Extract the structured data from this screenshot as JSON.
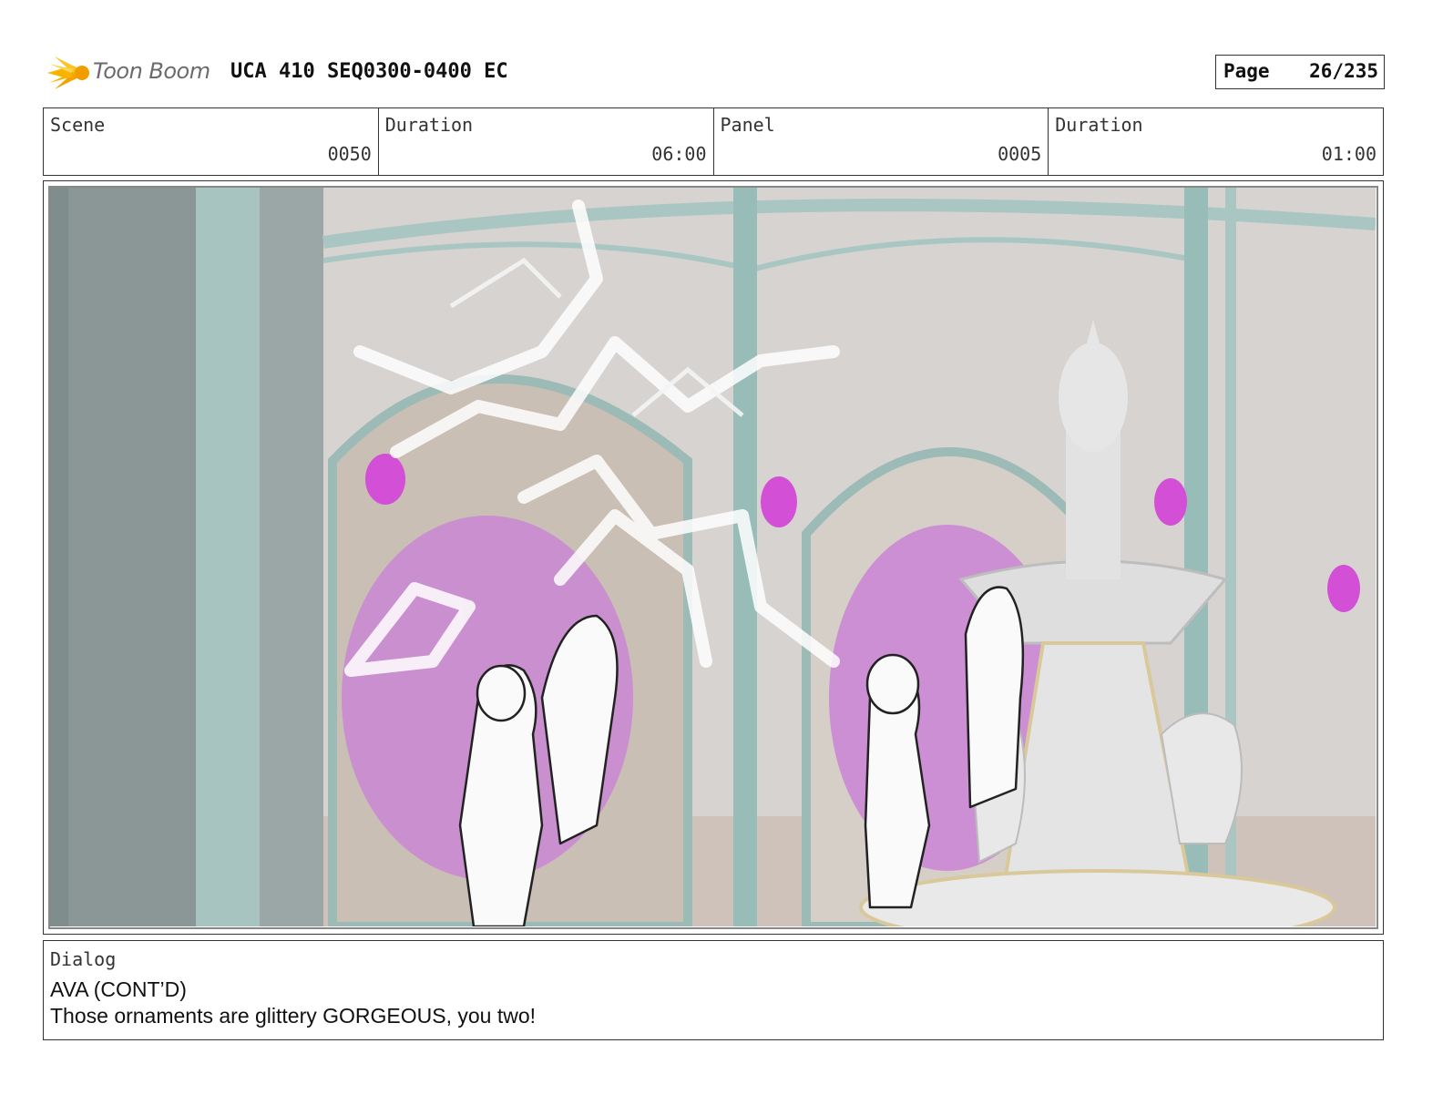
{
  "header": {
    "logo_text": "Toon Boom",
    "title": "UCA 410 SEQ0300-0400 EC",
    "page_label": "Page",
    "page_value": "26/235"
  },
  "info": {
    "scene_label": "Scene",
    "scene_value": "0050",
    "scene_duration_label": "Duration",
    "scene_duration_value": "06:00",
    "panel_label": "Panel",
    "panel_value": "0005",
    "panel_duration_label": "Duration",
    "panel_duration_value": "01:00"
  },
  "dialog": {
    "label": "Dialog",
    "character": "AVA (CONT’D)",
    "line": "Those ornaments are glittery GORGEOUS, you two!"
  },
  "colors": {
    "logo_orange": "#f7b500",
    "pillar_teal": "#8fb5b2",
    "magenta": "#d24fd6",
    "wall_gray": "#dcdcdc"
  }
}
